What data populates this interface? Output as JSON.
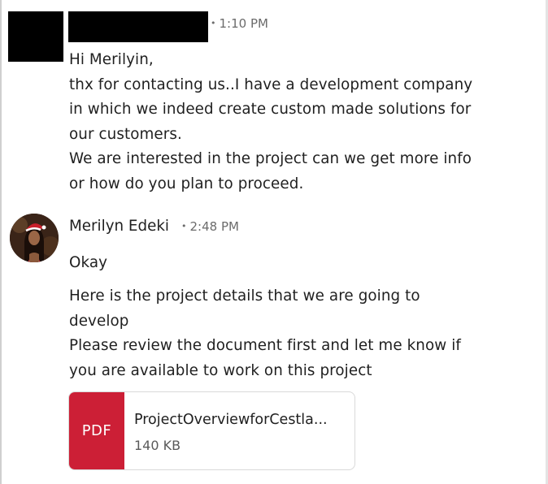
{
  "messages": [
    {
      "sender": "",
      "time": "1:10 PM",
      "lines": [
        "Hi Merilyin,",
        "thx for contacting us..I have a development company",
        "in which we indeed create custom made solutions for",
        "our customers.",
        "We are interested in the project can we get more info",
        "or how do you plan to proceed."
      ]
    },
    {
      "sender": "Merilyn Edeki",
      "time": "2:48 PM",
      "paragraphs": [
        "Okay",
        "Here is the project details that we are going to",
        "develop",
        "Please review the document first and let me know if",
        "you are available to work on this project"
      ],
      "attachment": {
        "type_label": "PDF",
        "file_name": "ProjectOverviewforCestla...",
        "file_size": "140 KB",
        "type_color": "#cc1f36"
      }
    }
  ],
  "separator": "•",
  "colors": {
    "accent_pdf": "#cc1f36",
    "meta": "#6b6b6b"
  }
}
